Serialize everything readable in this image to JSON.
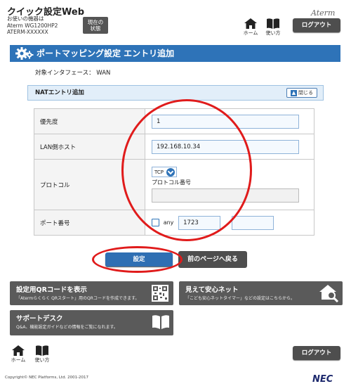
{
  "header": {
    "app_title": "クイック設定Web",
    "model_info": [
      "お使いの機器は",
      "Aterm WG1200HP2",
      "ATERM-XXXXXX"
    ],
    "status_button": [
      "現在の",
      "状態"
    ],
    "brand": "Aterm",
    "home_label": "ホーム",
    "help_label": "使い方",
    "logout_label": "ログアウト"
  },
  "page": {
    "title": "ポートマッピング設定 エントリ追加",
    "interface_label": "対象インタフェース：",
    "interface_value": "WAN"
  },
  "nat_section": {
    "title": "NATエントリ追加",
    "close_label": "閉じる",
    "close_icon": "chevron-up-icon",
    "rows": {
      "priority": {
        "label": "優先度",
        "value": "1"
      },
      "lan_host": {
        "label": "LAN側ホスト",
        "value": "192.168.10.34"
      },
      "protocol": {
        "label": "プロトコル",
        "selected": "TCP",
        "number_label": "プロトコル番号",
        "number_value": ""
      },
      "port": {
        "label": "ポート番号",
        "any_label": "any",
        "any_checked": false,
        "port_start": "1723",
        "port_end": ""
      }
    }
  },
  "actions": {
    "submit_label": "設定",
    "back_label": "前のページへ戻る"
  },
  "tiles": {
    "qr": {
      "title": "設定用QRコードを表示",
      "desc": "「Atermらくらく QRスタート」用のQRコードを作成できます。",
      "icon": "qr-code-icon"
    },
    "safety": {
      "title": "見えて安心ネット",
      "desc": "「こども安心ネットタイマー」などの設定はこちらから。",
      "icon": "house-search-icon"
    },
    "support": {
      "title": "サポートデスク",
      "desc": "Q&A、機能設定ガイドなどの情報をご覧になれます。",
      "icon": "book-icon"
    }
  },
  "footer": {
    "home_label": "ホーム",
    "help_label": "使い方",
    "logout_label": "ログアウト",
    "copyright": "Copyright© NEC Platforms, Ltd. 2001-2017",
    "logo": "NEC"
  },
  "colors": {
    "primary_blue": "#2e73b8",
    "dark_button": "#4e4e4e",
    "tile_gray": "#5a5a5a",
    "annotation_red": "#e01b1b"
  }
}
